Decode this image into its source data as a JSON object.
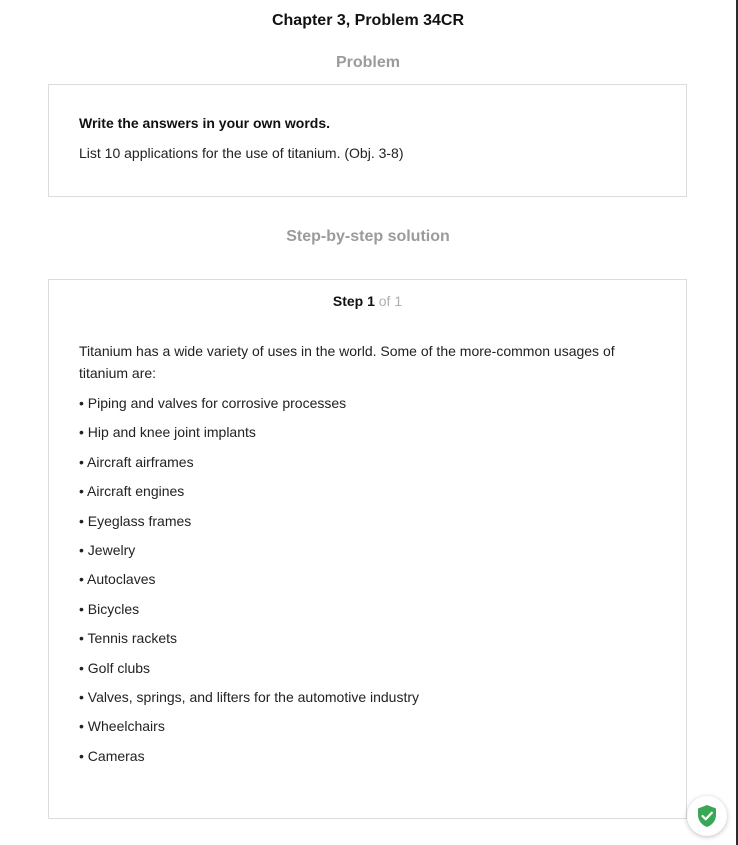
{
  "header": {
    "title": "Chapter 3, Problem 34CR"
  },
  "problem": {
    "heading": "Problem",
    "instruction": "Write the answers in your own words.",
    "text": "List 10 applications for the use of titanium. (Obj. 3-8)"
  },
  "solution": {
    "heading": "Step-by-step solution",
    "step_label": "Step 1",
    "step_of": "of 1",
    "intro": "Titanium has a wide variety of uses in the world. Some of the more-common usages of titanium are:",
    "applications": [
      "• Piping and valves for corrosive processes",
      "• Hip and knee joint implants",
      "• Aircraft airframes",
      "• Aircraft engines",
      "• Eyeglass frames",
      "• Jewelry",
      "• Autoclaves",
      "• Bicycles",
      "• Tennis rackets",
      "• Golf clubs",
      "• Valves, springs, and lifters for the automotive industry",
      "• Wheelchairs",
      "• Cameras"
    ]
  },
  "badge": {
    "icon": "shield-check-icon",
    "color": "#3aa757"
  }
}
